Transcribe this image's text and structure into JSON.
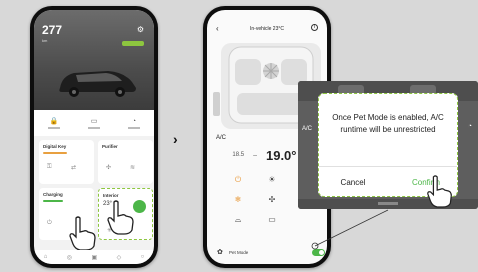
{
  "phone1": {
    "temperature": "277",
    "temperature_unit": "km",
    "quick_labels": [
      "",
      "",
      ""
    ],
    "cards": {
      "card1_title": "Digital Key",
      "card2_title": "Purifier",
      "card3_title": "Charging",
      "card4_title": "Interior",
      "card4_value": "23°"
    }
  },
  "phone2": {
    "header_title": "In-vehicle 23°C",
    "ac_label": "A/C",
    "temp_left": "18.5",
    "temp_main": "19.0°",
    "pet_mode_label": "Pet Mode",
    "pet_mode_on": true
  },
  "popup": {
    "ac_label": "A/C",
    "message": "Once Pet Mode is enabled, A/C runtime will be unrestricted",
    "cancel_label": "Cancel",
    "confirm_label": "Confirm"
  },
  "colors": {
    "accent_green": "#4cb648",
    "highlight_green": "#8dc63f",
    "accent_orange": "#e89a3b"
  }
}
